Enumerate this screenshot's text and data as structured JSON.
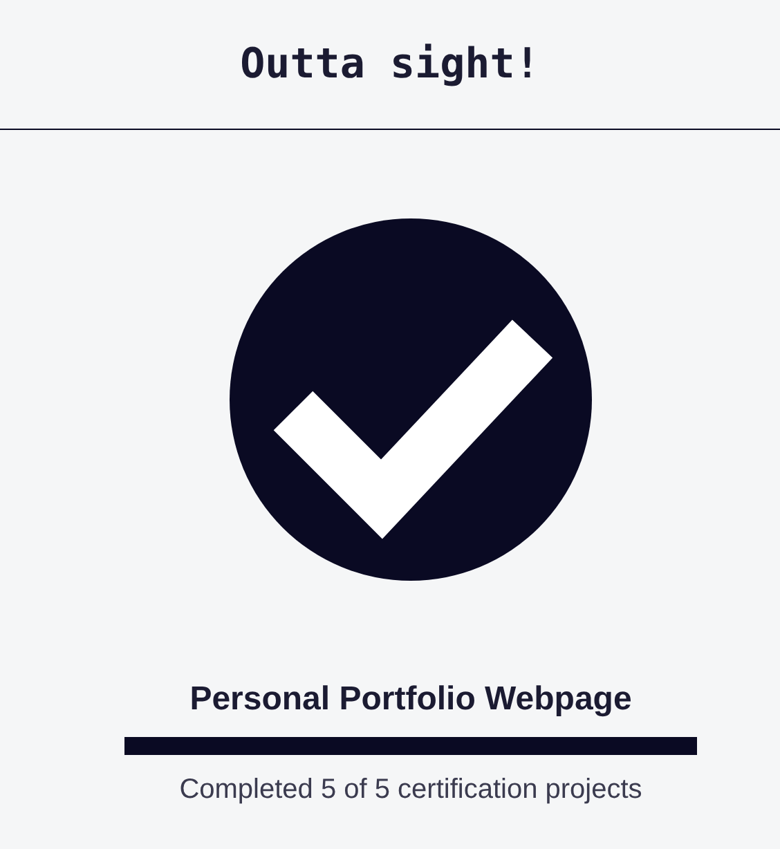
{
  "header": {
    "title": "Outta sight!"
  },
  "project": {
    "title": "Personal Portfolio Webpage",
    "progress": {
      "level": 1
    },
    "summary": "Completed 5 of 5 certification projects"
  }
}
